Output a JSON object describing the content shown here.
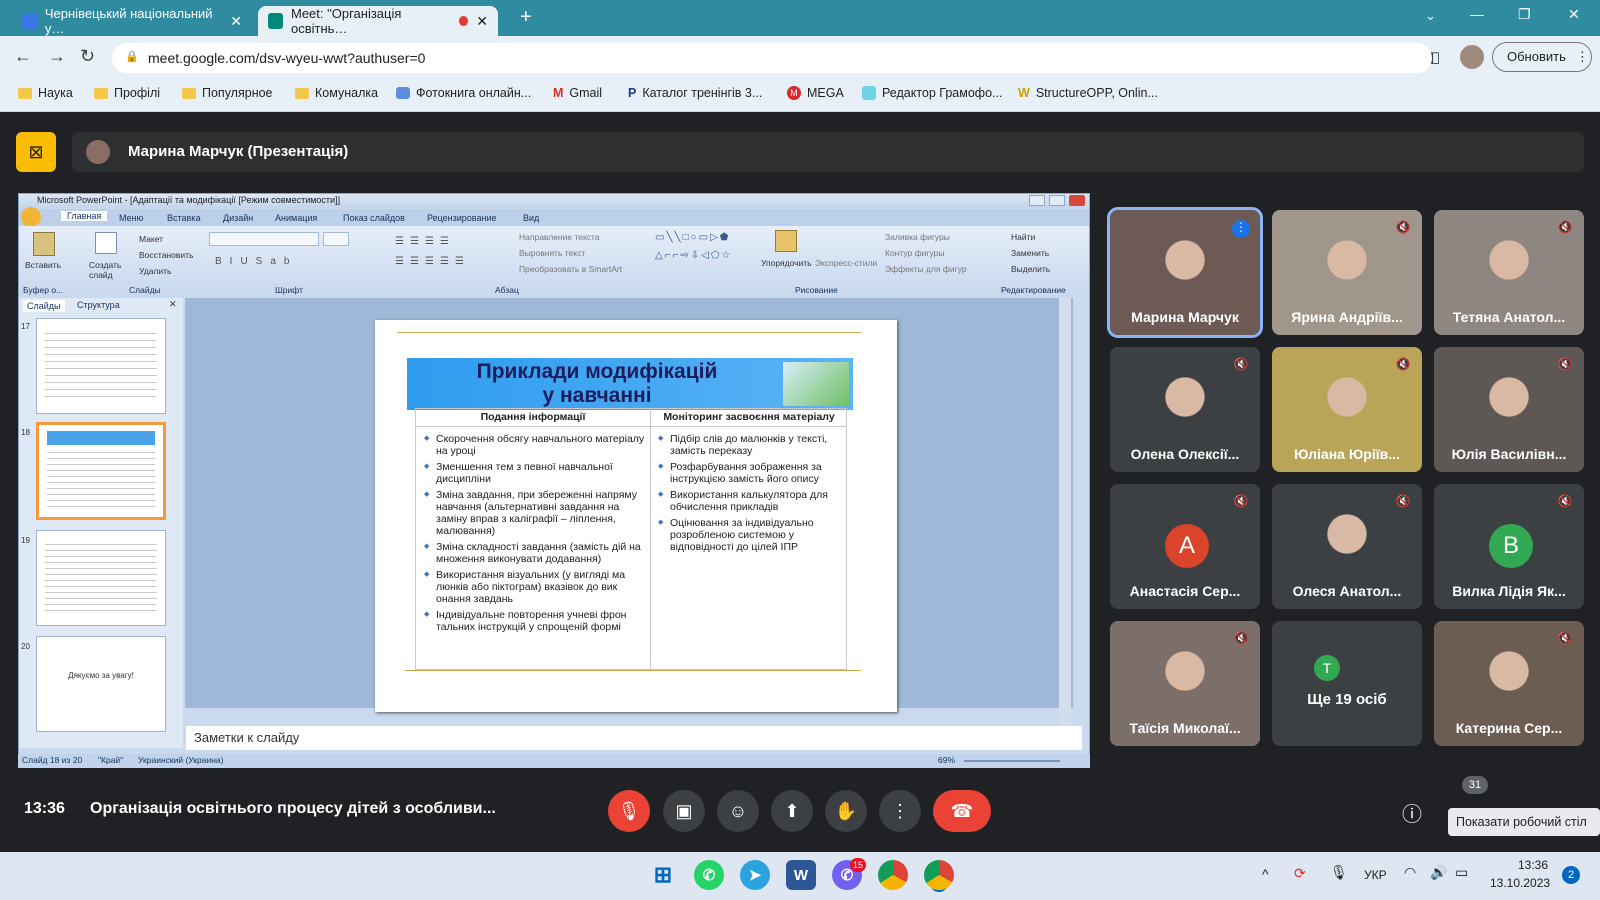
{
  "browser": {
    "tabs": [
      {
        "label": "Чернівецький національний у…",
        "icon_color": "#3b78e7"
      },
      {
        "label": "Meet: \"Організація освітнь…",
        "icon_color": "#00897b"
      }
    ],
    "new_tab": "+",
    "url": "meet.google.com/dsv-wyeu-wwt?authuser=0",
    "update_button": "Обновить",
    "window_controls": [
      "⌄",
      "—",
      "❐",
      "✕"
    ],
    "bookmarks": [
      "Наука",
      "Профілі",
      "Популярное",
      "Комуналка",
      "Фотокнига онлайн...",
      "Gmail",
      "Каталог тренінгів 3...",
      "MEGA",
      "Редактор Грамофо...",
      "StructureOPP, Onlin..."
    ]
  },
  "meet": {
    "presenter_label": "Марина Марчук (Презентація)",
    "time": "13:36",
    "meeting_title": "Організація освітнього процесу дітей з особливи...",
    "participants_count": "31",
    "tooltip": "Показати робочий стіл",
    "tiles": [
      {
        "name": "Марина Марчук",
        "speaking": true,
        "bg": "#6d5a55"
      },
      {
        "name": "Ярина Андріїв...",
        "bg": "#a0968c"
      },
      {
        "name": "Тетяна Анатол...",
        "bg": "#8e8680"
      },
      {
        "name": "Олена Олексії...",
        "bg": "#3c4043"
      },
      {
        "name": "Юліана Юріїв...",
        "bg": "#b9a458"
      },
      {
        "name": "Юлія Василівн...",
        "bg": "#5d5855"
      },
      {
        "name": "Анастасія Сер...",
        "initial": "А",
        "avatar_color": "#d9442b"
      },
      {
        "name": "Олеся Анатол...",
        "bg": "#3c4043"
      },
      {
        "name": "Вилка Лідія Як...",
        "initial": "В",
        "avatar_color": "#33a852"
      },
      {
        "name": "Таїсія Миколаї...",
        "bg": "#7c6f6a"
      },
      {
        "name": "Ще 19 осіб",
        "initial": "Т",
        "avatar_color": "#33a852"
      },
      {
        "name": "Катерина Сер...",
        "bg": "#6b5d52"
      }
    ]
  },
  "ppt": {
    "window_title": "Microsoft PowerPoint - [Адаптації та модифікації [Режим совместимости]]",
    "ribbon_tabs": [
      "Главная",
      "Меню",
      "Вставка",
      "Дизайн",
      "Анимация",
      "Показ слайдов",
      "Рецензирование",
      "Вид"
    ],
    "ribbon_items": {
      "paste": "Вставить",
      "create_slide": "Создать слайд",
      "layout": "Макет",
      "restore": "Восстановить",
      "delete": "Удалить",
      "text_dir": "Направление текста",
      "align_text": "Выровнять текст",
      "smartart": "Преобразовать в SmartArt",
      "arrange": "Упорядочить",
      "express": "Экспресс-стили",
      "fill": "Заливка фигуры",
      "outline": "Контур фигуры",
      "effects": "Эффекты для фигур",
      "find": "Найти",
      "replace": "Заменить",
      "select": "Выделить"
    },
    "groups": [
      "Буфер о...",
      "Слайды",
      "Шрифт",
      "Абзац",
      "Рисование",
      "Редактирование"
    ],
    "panel_tabs": [
      "Слайды",
      "Структура"
    ],
    "thumb_numbers": [
      "17",
      "18",
      "19",
      "20"
    ],
    "thumb_last_text": "Дякуємо за увагу!",
    "notes_placeholder": "Заметки к слайду",
    "status": [
      "Слайд 18 из 20",
      "\"Край\"",
      "Украинский (Украина)"
    ],
    "zoom": "69%",
    "slide": {
      "title_line1": "Приклади модифікацій",
      "title_line2": "у навчанні",
      "col1_header": "Подання інформації",
      "col2_header": "Моніторинг засвоєння матеріалу",
      "col1_items": [
        "Скорочення обсягу навчального матеріалу на уроці",
        "Зменшення тем з певної навчальної дисципліни",
        "Зміна завдання, при збереженні напряму навчання (альтернативні завдання на заміну вправ з каліграфії – ліплення, малювання)",
        "Зміна складності завдання (замість дій на множення виконувати додавання)",
        "Використання візуальних (у вигляді ма люнків або піктограм) вказівок до вик онання завдань",
        "Індивідуальне повторення учневі фрон тальних інструкцій у спрощеній формі"
      ],
      "col2_items": [
        "Підбір слів до малюнків у тексті, замість переказу",
        "Розфарбування зображення за інструкцією замість його опису",
        "Використання калькулятора для обчислення прикладів",
        "Оцінювання за індивідуально розробленою системою у відповідності до цілей ІПР"
      ]
    }
  },
  "taskbar": {
    "lang": "УКР",
    "time": "13:36",
    "date": "13.10.2023",
    "notif": "2",
    "viber_badge": "15"
  }
}
